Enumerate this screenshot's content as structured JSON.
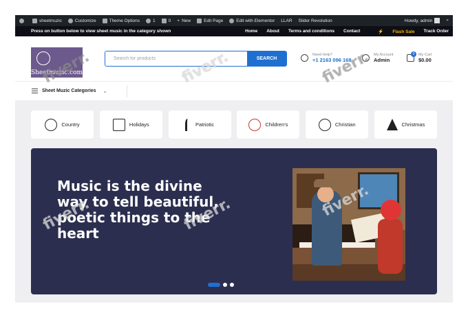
{
  "adminbar": {
    "items": [
      "sheetmuzic",
      "Customize",
      "Theme Options",
      "1",
      "0",
      "New",
      "Edit Page",
      "Edit with Elementor",
      "LLAR",
      "Slider Revolution"
    ],
    "greeting": "Howdy, admin"
  },
  "topbar": {
    "notice": "Press on button below to view sheet music in the category shown",
    "nav": [
      "Home",
      "About",
      "Terms and conditions",
      "Contact",
      "Flash Sale",
      "Track Order"
    ],
    "flash_color": "#f5b400"
  },
  "header": {
    "logo_text": "Sheetmuzic.com",
    "search_placeholder": "Search for products",
    "search_button": "SEARCH",
    "help_label": "Need Help?",
    "help_phone": "+1 2163 096 168",
    "account_label": "My Account",
    "account_value": "Admin",
    "cart_label": "My Cart",
    "cart_value": "$0.00",
    "cart_count": "0",
    "accent": "#1f6fd1"
  },
  "catbar": {
    "label": "Sheet Muzic Categories"
  },
  "categories": [
    {
      "label": "Country",
      "icon": "globe-icon"
    },
    {
      "label": "Holidays",
      "icon": "calendar-icon"
    },
    {
      "label": "Patriotic",
      "icon": "person-icon"
    },
    {
      "label": "Children's",
      "icon": "children-icon"
    },
    {
      "label": "Christian",
      "icon": "christian-icon"
    },
    {
      "label": "Christmas",
      "icon": "christmas-tree-icon"
    }
  ],
  "hero": {
    "headline": "Music is the divine way to tell beautiful, poetic things to the heart",
    "background": "#2c2e4f",
    "slide_count": 3,
    "active_slide": 1
  },
  "watermark": "fiverr."
}
